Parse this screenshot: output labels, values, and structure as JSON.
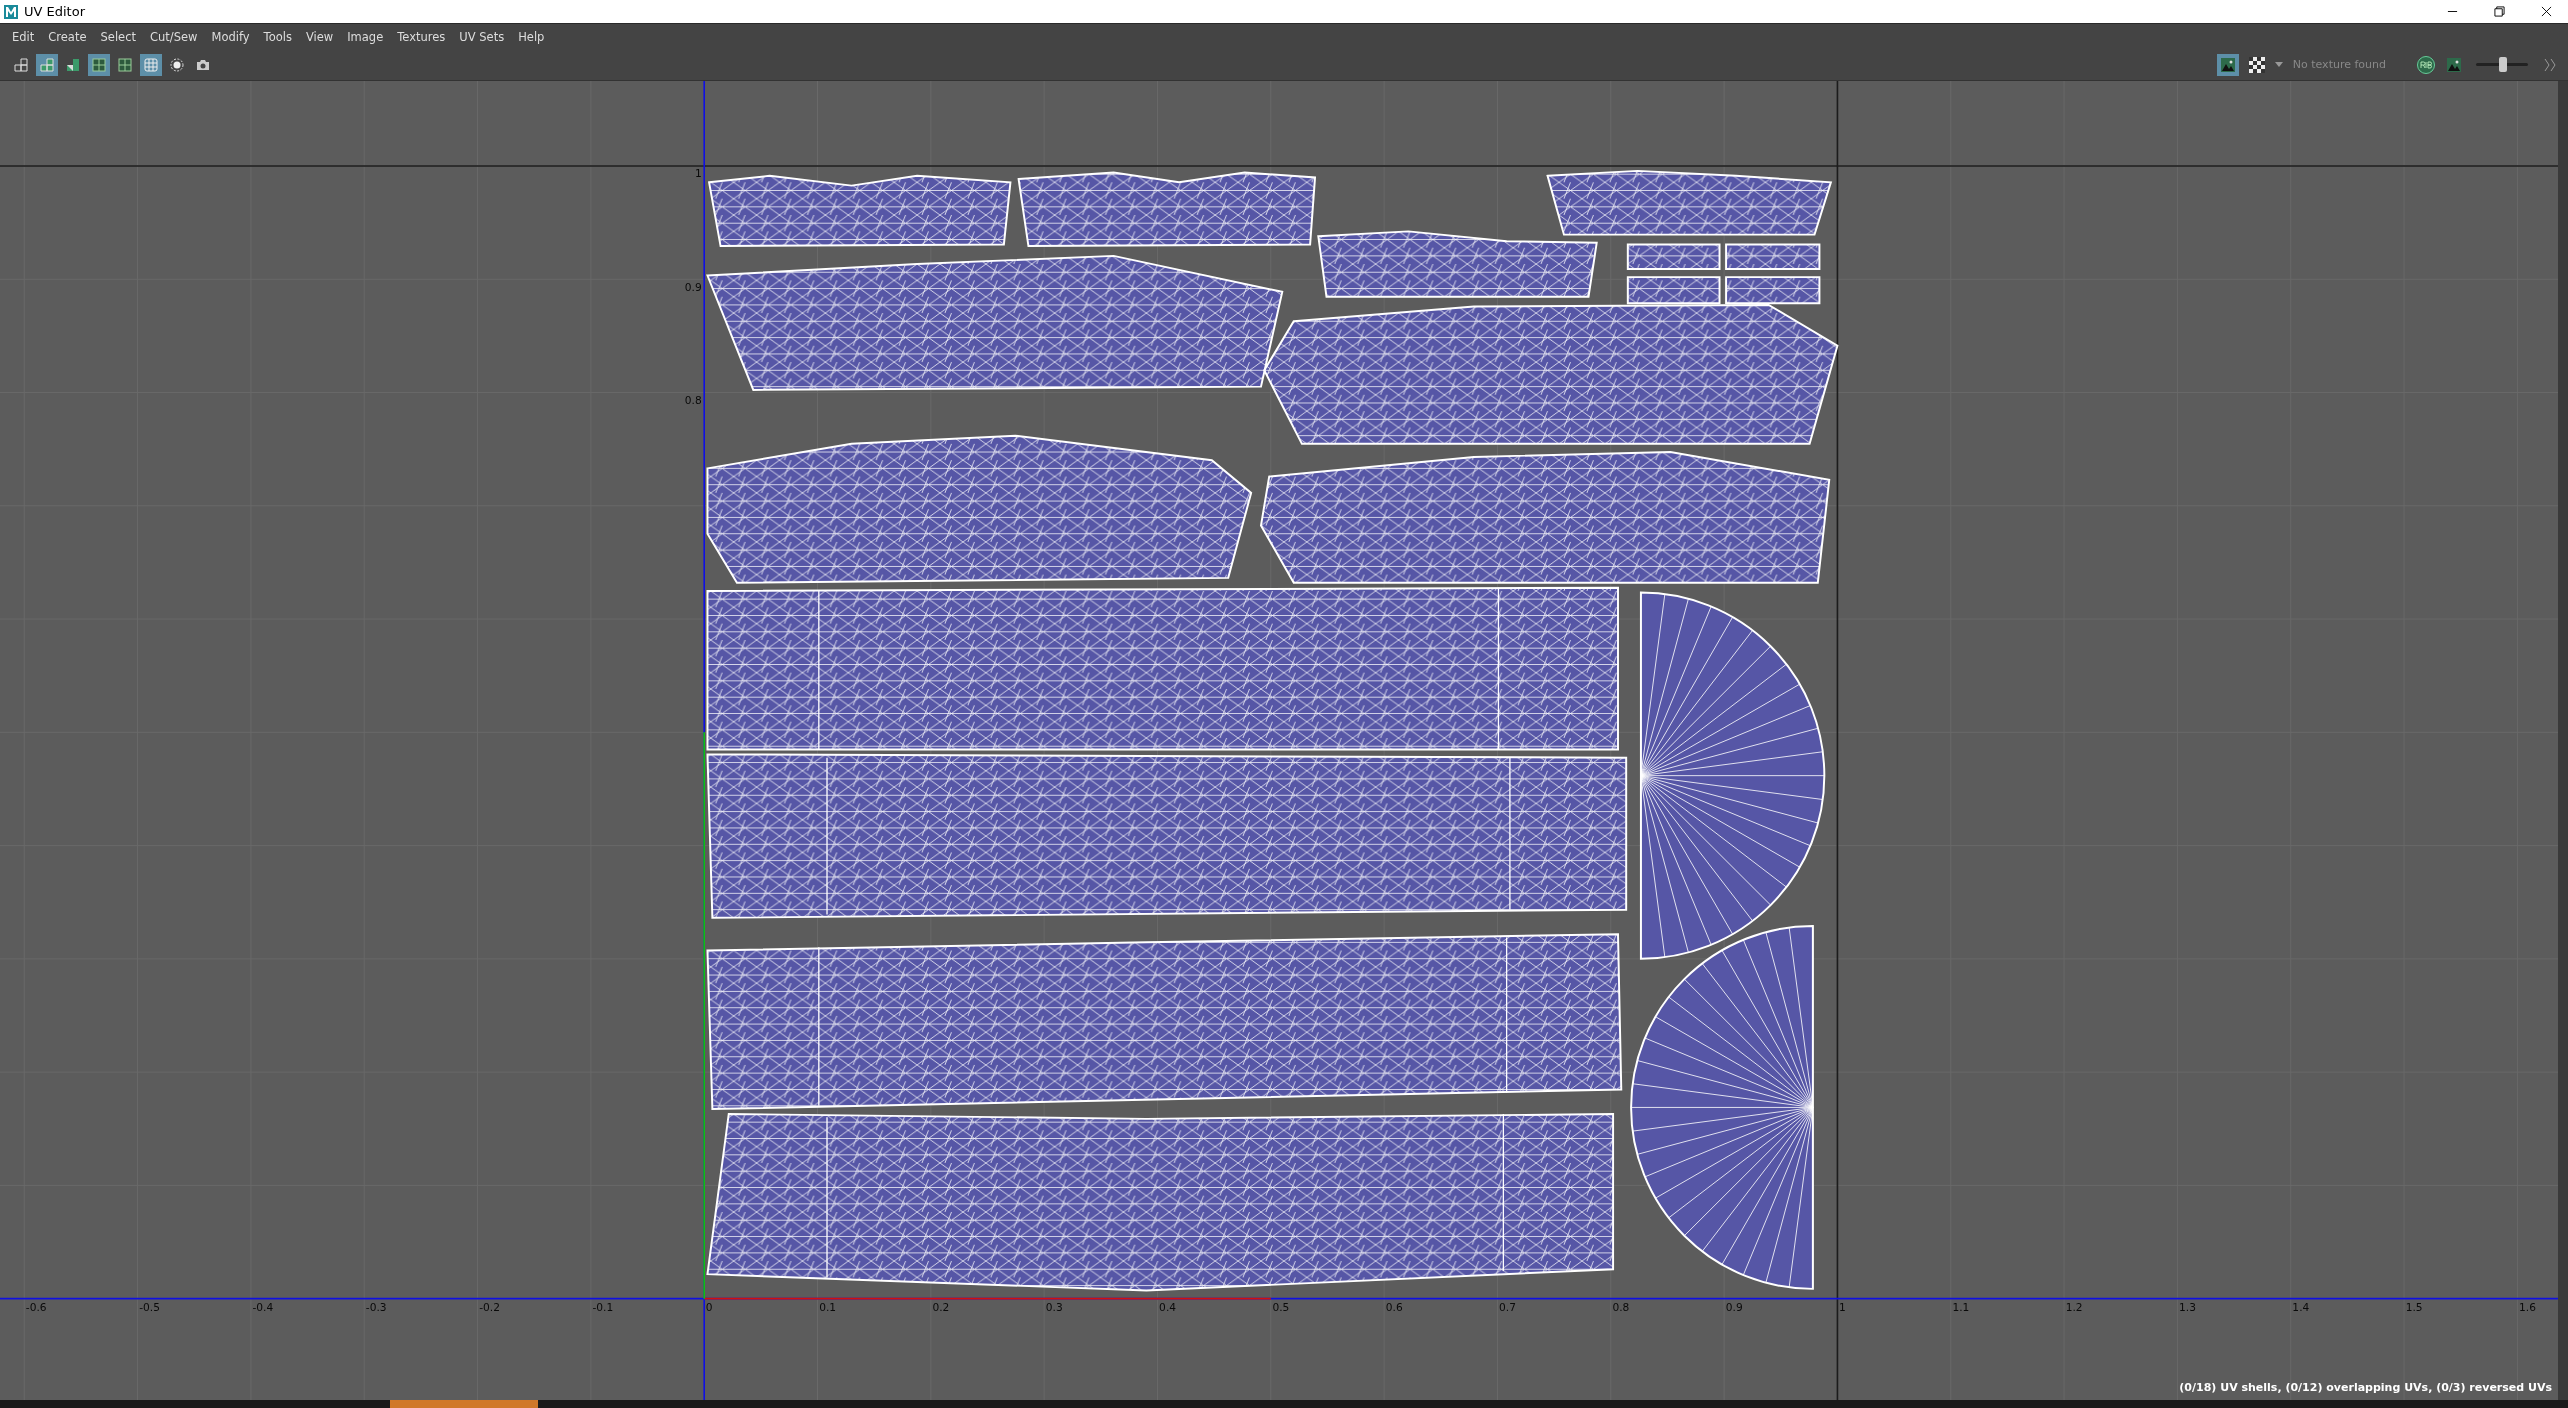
{
  "window": {
    "title": "UV Editor"
  },
  "menu": [
    "Edit",
    "Create",
    "Select",
    "Cut/Sew",
    "Modify",
    "Tools",
    "View",
    "Image",
    "Textures",
    "UV Sets",
    "Help"
  ],
  "toolbar": [
    {
      "kind": "outline",
      "selected": false
    },
    {
      "kind": "filled",
      "selected": true
    },
    {
      "kind": "split",
      "selected": false
    },
    {
      "kind": "frame",
      "selected": true
    },
    {
      "kind": "frame",
      "selected": false
    },
    {
      "kind": "dots",
      "selected": true
    },
    {
      "kind": "ring",
      "selected": false
    },
    {
      "kind": "camera",
      "selected": false
    }
  ],
  "texture_bar": {
    "image_selected": true,
    "status": "No texture found",
    "exposure": {
      "level": 0.52
    }
  },
  "viewport": {
    "u_ticks": [
      "-0.6",
      "-0.5",
      "-0.4",
      "-0.3",
      "-0.2",
      "-0.1",
      "0",
      "0.1",
      "0.2",
      "0.3",
      "0.4",
      "0.5",
      "0.6",
      "0.7",
      "0.8",
      "0.9",
      "1",
      "1.1",
      "1.2",
      "1.3",
      "1.4",
      "1.5",
      "1.6"
    ],
    "v_ticks": [
      "1",
      "0.9",
      "0.8"
    ],
    "status": "(0/18) UV shells, (0/12) overlapping UVs, (0/3) reversed UVs"
  }
}
